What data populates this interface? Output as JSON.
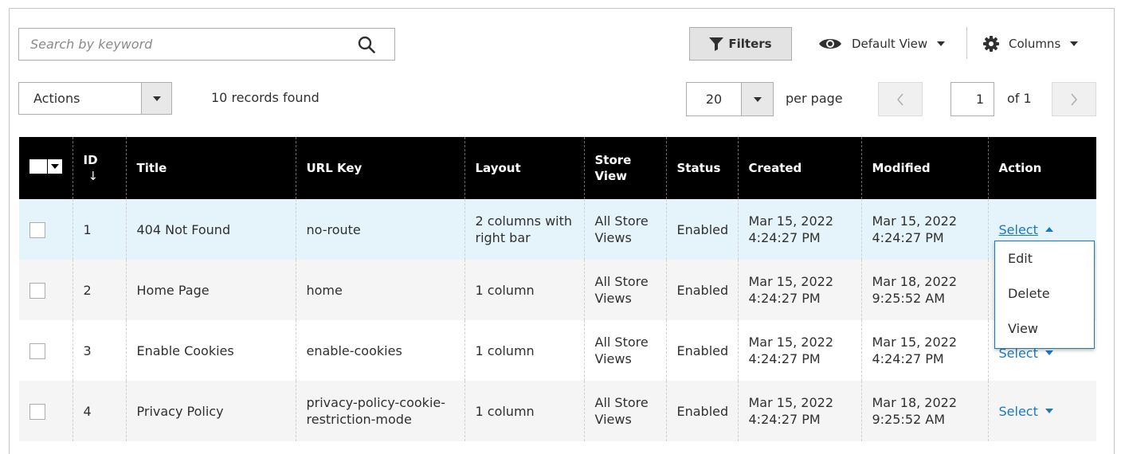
{
  "toolbar": {
    "search_placeholder": "Search by keyword",
    "filters_label": "Filters",
    "view_label": "Default View",
    "columns_label": "Columns"
  },
  "mass_actions": {
    "label": "Actions",
    "records_found": "10 records found"
  },
  "pagination": {
    "per_page_value": "20",
    "per_page_label": "per page",
    "current_page": "1",
    "of_label": "of 1"
  },
  "columns": [
    "ID",
    "Title",
    "URL Key",
    "Layout",
    "Store View",
    "Status",
    "Created",
    "Modified",
    "Action"
  ],
  "sort": {
    "column": "ID",
    "direction": "descending-arrow"
  },
  "rows": [
    {
      "id": "1",
      "title": "404 Not Found",
      "url_key": "no-route",
      "layout": "2 columns with right bar",
      "store_view": "All Store Views",
      "status": "Enabled",
      "created": "Mar 15, 2022 4:24:27 PM",
      "modified": "Mar 15, 2022 4:24:27 PM",
      "action": "Select"
    },
    {
      "id": "2",
      "title": "Home Page",
      "url_key": "home",
      "layout": "1 column",
      "store_view": "All Store Views",
      "status": "Enabled",
      "created": "Mar 15, 2022 4:24:27 PM",
      "modified": "Mar 18, 2022 9:25:52 AM",
      "action": ""
    },
    {
      "id": "3",
      "title": "Enable Cookies",
      "url_key": "enable-cookies",
      "layout": "1 column",
      "store_view": "All Store Views",
      "status": "Enabled",
      "created": "Mar 15, 2022 4:24:27 PM",
      "modified": "Mar 15, 2022 4:24:27 PM",
      "action": "Select"
    },
    {
      "id": "4",
      "title": "Privacy Policy",
      "url_key": "privacy-policy-cookie-restriction-mode",
      "layout": "1 column",
      "store_view": "All Store Views",
      "status": "Enabled",
      "created": "Mar 15, 2022 4:24:27 PM",
      "modified": "Mar 18, 2022 9:25:52 AM",
      "action": "Select"
    }
  ],
  "action_menu": {
    "items": [
      "Edit",
      "Delete",
      "View"
    ]
  },
  "colors": {
    "link": "#1979c3",
    "header_bg": "#000000",
    "highlight_row": "#e5f3fb"
  },
  "icons": [
    "search-icon",
    "filter-icon",
    "eye-icon",
    "gear-icon",
    "chevron-left-icon",
    "chevron-right-icon"
  ]
}
